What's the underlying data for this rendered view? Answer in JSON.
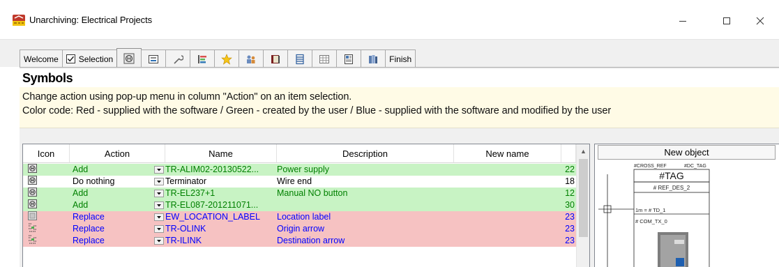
{
  "window": {
    "title": "Unarchiving: Electrical Projects"
  },
  "tabs": [
    {
      "label": "Welcome",
      "type": "text"
    },
    {
      "label": "Selection",
      "type": "check",
      "checked": true
    },
    {
      "icon": "symbol-icon",
      "type": "icon",
      "active": true
    },
    {
      "icon": "form-icon",
      "type": "icon"
    },
    {
      "icon": "wrench-icon",
      "type": "icon"
    },
    {
      "icon": "bars-icon",
      "type": "icon"
    },
    {
      "icon": "star-icon",
      "type": "icon"
    },
    {
      "icon": "users-icon",
      "type": "icon"
    },
    {
      "icon": "book-icon",
      "type": "icon"
    },
    {
      "icon": "list-icon",
      "type": "icon"
    },
    {
      "icon": "table-icon",
      "type": "icon"
    },
    {
      "icon": "document-icon",
      "type": "icon"
    },
    {
      "icon": "archive-icon",
      "type": "icon"
    },
    {
      "label": "Finish",
      "type": "text"
    }
  ],
  "page": {
    "title": "Symbols",
    "info_line1": "Change action using pop-up menu in column \"Action\" on an item selection.",
    "info_line2": "Color code: Red - supplied with the software / Green - created by the user / Blue - supplied with the software and modified by the user"
  },
  "grid": {
    "columns": {
      "icon": "Icon",
      "action": "Action",
      "name": "Name",
      "description": "Description",
      "new_name": "New name"
    },
    "rows": [
      {
        "color": "green",
        "fg": "green",
        "icon": "symbol-icon",
        "action": "Add",
        "name": "TR-ALIM02-20130522...",
        "description": "Power supply",
        "new_name": "",
        "num": "22"
      },
      {
        "color": "white",
        "fg": "black",
        "icon": "symbol-icon",
        "action": "Do nothing",
        "name": "Terminator",
        "description": "Wire end",
        "new_name": "",
        "num": "18"
      },
      {
        "color": "green",
        "fg": "green",
        "icon": "symbol-icon",
        "action": "Add",
        "name": "TR-EL237+1",
        "description": "Manual NO button",
        "new_name": "",
        "num": "12"
      },
      {
        "color": "green",
        "fg": "green",
        "icon": "symbol-icon",
        "action": "Add",
        "name": "TR-EL087-201211071...",
        "description": "",
        "new_name": "",
        "num": "30"
      },
      {
        "color": "red",
        "fg": "blue",
        "icon": "label-icon",
        "action": "Replace",
        "name": "EW_LOCATION_LABEL",
        "description": "Location label",
        "new_name": "",
        "num": "23"
      },
      {
        "color": "red",
        "fg": "blue",
        "icon": "link-icon",
        "action": "Replace",
        "name": "TR-OLINK",
        "description": "Origin arrow",
        "new_name": "",
        "num": "23"
      },
      {
        "color": "red",
        "fg": "blue",
        "icon": "link-icon",
        "action": "Replace",
        "name": "TR-ILINK",
        "description": "Destination arrow",
        "new_name": "",
        "num": "23"
      }
    ]
  },
  "preview": {
    "header": "New object",
    "cross_ref": "#CROSS_REF",
    "dc_tag": "#DC_TAG",
    "tag": "#TAG",
    "ref_des": "# REF_DES_2",
    "td": "1m = # TD_1",
    "com_tx": "# COM_TX_0"
  },
  "colors": {
    "row_green": "#c8f3c4",
    "row_red": "#f6c2c2",
    "info_bg": "#fffbe6",
    "text_green": "#008000",
    "text_blue": "#0000ff"
  }
}
